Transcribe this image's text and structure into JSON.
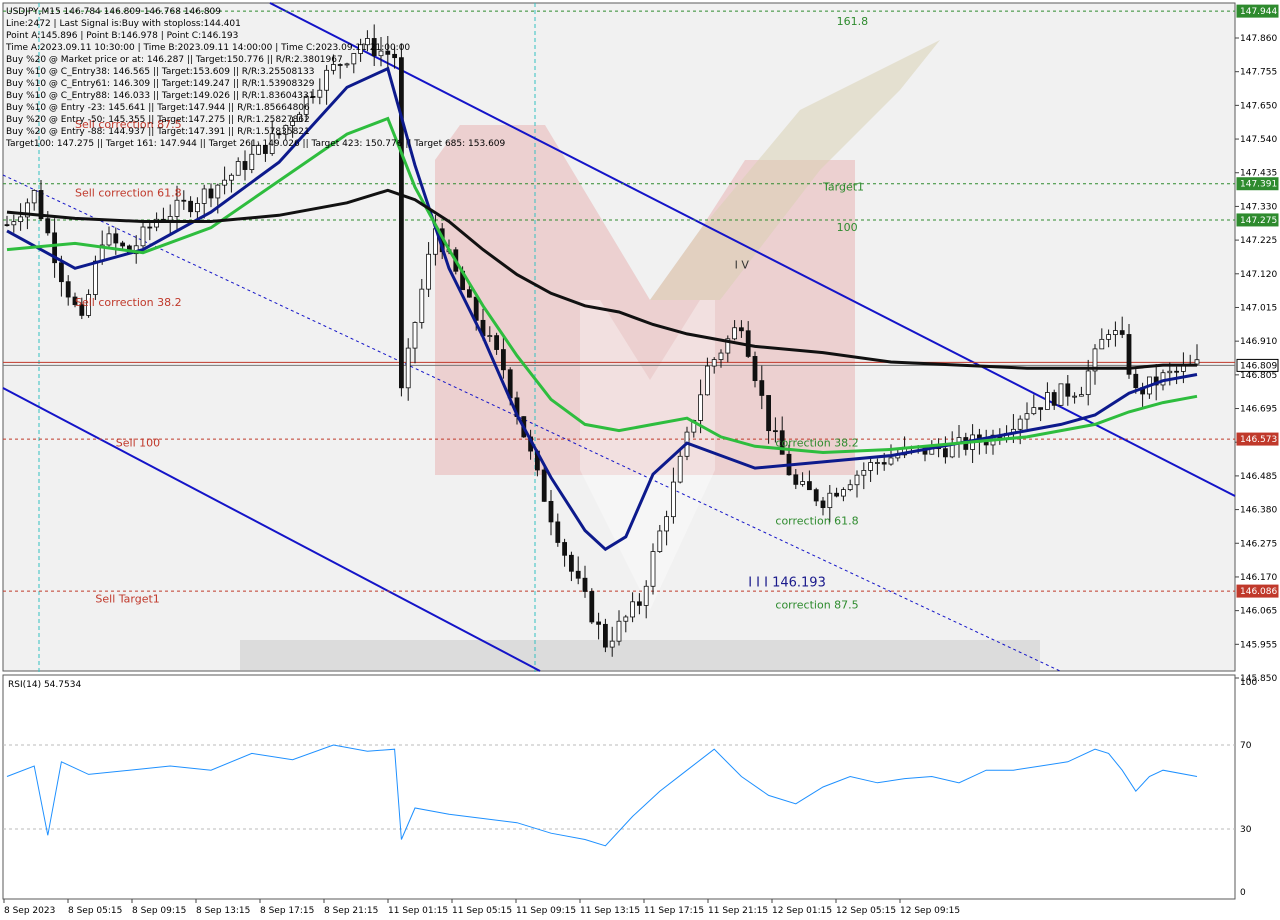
{
  "header": {
    "symbol_line": "USDJPY,M15  146.784 146.809 146.768 146.809",
    "info_lines": [
      "Line:2472 | Last Signal is:Buy with stoploss:144.401",
      "Point A:145.896 | Point B:146.978 | Point C:146.193",
      "Time A:2023.09.11 10:30:00 | Time B:2023.09.11 14:00:00 | Time C:2023.09.11 21:00:00",
      "Buy %20 @ Market price or at: 146.287 || Target:150.776 || R/R:2.3801967",
      "Buy %10 @ C_Entry38: 146.565 || Target:153.609 || R/R:3.25508133",
      "Buy %10 @ C_Entry61: 146.309 || Target:149.247 || R/R:1.53908329",
      "Buy %10 @ C_Entry88: 146.033 || Target:149.026 || R/R:1.83604331",
      "Buy %10 @ Entry -23: 145.641 || Target:147.944 || R/R:1.85664806",
      "Buy %20 @ Entry -50: 145.355 || Target:147.275 || R/R:1.25827862",
      "Buy %20 @ Entry -88: 144.937 || Target:147.391 || R/R:1.57835821",
      "Target100: 147.275 || Target 161: 147.944 || Target 261: 149.026 || Target 423: 150.776 || Target 685: 153.609"
    ]
  },
  "chart_data": {
    "type": "candlestick",
    "title": "USDJPY,M15",
    "x_tick_labels": [
      "8 Sep 2023",
      "8 Sep 05:15",
      "8 Sep 09:15",
      "8 Sep 13:15",
      "8 Sep 17:15",
      "8 Sep 21:15",
      "11 Sep 01:15",
      "11 Sep 05:15",
      "11 Sep 09:15",
      "11 Sep 13:15",
      "11 Sep 17:15",
      "11 Sep 21:15",
      "12 Sep 01:15",
      "12 Sep 05:15",
      "12 Sep 09:15"
    ],
    "price_ticks": [
      "147.860",
      "147.755",
      "147.650",
      "147.540",
      "147.435",
      "147.330",
      "147.225",
      "147.120",
      "147.015",
      "146.910",
      "146.805",
      "146.695",
      "146.590",
      "146.485",
      "146.380",
      "146.275",
      "146.170",
      "146.065",
      "145.955",
      "145.850"
    ],
    "ylim": [
      145.83,
      147.97
    ],
    "price_path": [
      [
        0,
        147.26
      ],
      [
        4,
        147.36
      ],
      [
        8,
        147.1
      ],
      [
        11,
        146.94
      ],
      [
        14,
        147.22
      ],
      [
        18,
        147.17
      ],
      [
        22,
        147.28
      ],
      [
        27,
        147.33
      ],
      [
        33,
        147.42
      ],
      [
        40,
        147.55
      ],
      [
        46,
        147.72
      ],
      [
        52,
        147.84
      ],
      [
        57,
        147.8
      ],
      [
        58,
        146.72
      ],
      [
        60,
        146.95
      ],
      [
        63,
        147.25
      ],
      [
        68,
        147.0
      ],
      [
        73,
        146.8
      ],
      [
        78,
        146.45
      ],
      [
        83,
        146.15
      ],
      [
        88,
        145.92
      ],
      [
        93,
        146.05
      ],
      [
        98,
        146.42
      ],
      [
        103,
        146.8
      ],
      [
        108,
        146.95
      ],
      [
        112,
        146.62
      ],
      [
        116,
        146.42
      ],
      [
        120,
        146.38
      ],
      [
        124,
        146.45
      ],
      [
        128,
        146.5
      ],
      [
        132,
        146.53
      ],
      [
        136,
        146.54
      ],
      [
        140,
        146.55
      ],
      [
        145,
        146.58
      ],
      [
        150,
        146.67
      ],
      [
        155,
        146.72
      ],
      [
        158,
        146.74
      ],
      [
        162,
        146.93
      ],
      [
        164,
        146.88
      ],
      [
        166,
        146.72
      ],
      [
        170,
        146.77
      ],
      [
        175,
        146.81
      ]
    ],
    "moving_averages": [
      {
        "name": "dark-blue",
        "color": "#0d1a8c",
        "points": [
          [
            0,
            147.24
          ],
          [
            10,
            147.12
          ],
          [
            20,
            147.18
          ],
          [
            30,
            147.3
          ],
          [
            40,
            147.46
          ],
          [
            50,
            147.7
          ],
          [
            56,
            147.76
          ],
          [
            60,
            147.45
          ],
          [
            65,
            147.12
          ],
          [
            70,
            146.9
          ],
          [
            75,
            146.65
          ],
          [
            80,
            146.45
          ],
          [
            85,
            146.28
          ],
          [
            88,
            146.22
          ],
          [
            91,
            146.26
          ],
          [
            95,
            146.46
          ],
          [
            100,
            146.56
          ],
          [
            105,
            146.52
          ],
          [
            110,
            146.48
          ],
          [
            120,
            146.5
          ],
          [
            130,
            146.52
          ],
          [
            140,
            146.56
          ],
          [
            150,
            146.6
          ],
          [
            155,
            146.62
          ],
          [
            160,
            146.65
          ],
          [
            165,
            146.72
          ],
          [
            170,
            146.76
          ],
          [
            175,
            146.78
          ]
        ]
      },
      {
        "name": "green",
        "color": "#2ebd3e",
        "points": [
          [
            0,
            147.18
          ],
          [
            10,
            147.2
          ],
          [
            20,
            147.17
          ],
          [
            30,
            147.25
          ],
          [
            40,
            147.4
          ],
          [
            50,
            147.55
          ],
          [
            56,
            147.6
          ],
          [
            60,
            147.38
          ],
          [
            65,
            147.18
          ],
          [
            70,
            147.0
          ],
          [
            75,
            146.84
          ],
          [
            80,
            146.7
          ],
          [
            85,
            146.62
          ],
          [
            90,
            146.6
          ],
          [
            95,
            146.62
          ],
          [
            100,
            146.64
          ],
          [
            105,
            146.58
          ],
          [
            110,
            146.55
          ],
          [
            120,
            146.53
          ],
          [
            130,
            146.54
          ],
          [
            140,
            146.56
          ],
          [
            150,
            146.58
          ],
          [
            155,
            146.6
          ],
          [
            160,
            146.62
          ],
          [
            165,
            146.66
          ],
          [
            170,
            146.69
          ],
          [
            175,
            146.71
          ]
        ]
      },
      {
        "name": "black",
        "color": "#111111",
        "points": [
          [
            0,
            147.3
          ],
          [
            10,
            147.28
          ],
          [
            20,
            147.27
          ],
          [
            30,
            147.27
          ],
          [
            40,
            147.29
          ],
          [
            50,
            147.33
          ],
          [
            56,
            147.37
          ],
          [
            60,
            147.34
          ],
          [
            65,
            147.27
          ],
          [
            70,
            147.18
          ],
          [
            75,
            147.1
          ],
          [
            80,
            147.04
          ],
          [
            85,
            147.0
          ],
          [
            90,
            146.98
          ],
          [
            95,
            146.94
          ],
          [
            100,
            146.91
          ],
          [
            110,
            146.87
          ],
          [
            120,
            146.85
          ],
          [
            130,
            146.82
          ],
          [
            140,
            146.81
          ],
          [
            150,
            146.8
          ],
          [
            160,
            146.8
          ],
          [
            165,
            146.8
          ],
          [
            170,
            146.81
          ],
          [
            175,
            146.81
          ]
        ]
      }
    ],
    "price_labels": [
      {
        "text": "147.944",
        "value": 147.944,
        "color": "#2e8b2e"
      },
      {
        "text": "147.391",
        "value": 147.391,
        "color": "#2e8b2e"
      },
      {
        "text": "147.275",
        "value": 147.275,
        "color": "#2e8b2e"
      },
      {
        "text": "146.809",
        "value": 146.809,
        "color": "#000000"
      },
      {
        "text": "146.573",
        "value": 146.573,
        "color": "#c0392b"
      },
      {
        "text": "146.086",
        "value": 146.086,
        "color": "#c0392b"
      }
    ],
    "annotations": [
      {
        "text": "161.8",
        "x": 122,
        "value": 147.9,
        "color": "#2e8b2e"
      },
      {
        "text": "Target1",
        "x": 120,
        "value": 147.37,
        "color": "#2e8b2e"
      },
      {
        "text": "100",
        "x": 122,
        "value": 147.24,
        "color": "#2e8b2e"
      },
      {
        "text": "I V",
        "x": 107,
        "value": 147.12,
        "color": "#333333"
      },
      {
        "text": "Sell correction 61.8",
        "x": 10,
        "value": 147.35,
        "color": "#c0392b"
      },
      {
        "text": "Sell correction 38.2",
        "x": 10,
        "value": 147.0,
        "color": "#c0392b"
      },
      {
        "text": "Sell correction 87.5",
        "x": 10,
        "value": 147.57,
        "color": "#c0392b"
      },
      {
        "text": "Sell 100",
        "x": 16,
        "value": 146.55,
        "color": "#c0392b"
      },
      {
        "text": "Sell Target1",
        "x": 13,
        "value": 146.05,
        "color": "#c0392b"
      },
      {
        "text": "correction 38.2",
        "x": 113,
        "value": 146.55,
        "color": "#2e8b2e"
      },
      {
        "text": "correction 61.8",
        "x": 113,
        "value": 146.3,
        "color": "#2e8b2e"
      },
      {
        "text": "correction 87.5",
        "x": 113,
        "value": 146.03,
        "color": "#2e8b2e"
      },
      {
        "text": "I I I 146.193",
        "x": 109,
        "value": 146.1,
        "color": "#1a1a8c"
      }
    ],
    "rsi": {
      "label": "RSI(14) 54.7534",
      "levels": [
        "100",
        "70",
        "30",
        "0"
      ],
      "ylim": [
        0,
        100
      ],
      "values": [
        [
          0,
          55
        ],
        [
          4,
          60
        ],
        [
          6,
          27
        ],
        [
          8,
          62
        ],
        [
          12,
          56
        ],
        [
          18,
          58
        ],
        [
          24,
          60
        ],
        [
          30,
          58
        ],
        [
          36,
          66
        ],
        [
          42,
          63
        ],
        [
          48,
          70
        ],
        [
          53,
          67
        ],
        [
          57,
          68
        ],
        [
          58,
          25
        ],
        [
          60,
          40
        ],
        [
          65,
          37
        ],
        [
          70,
          35
        ],
        [
          75,
          33
        ],
        [
          80,
          28
        ],
        [
          85,
          25
        ],
        [
          88,
          22
        ],
        [
          92,
          36
        ],
        [
          96,
          48
        ],
        [
          100,
          58
        ],
        [
          104,
          68
        ],
        [
          108,
          55
        ],
        [
          112,
          46
        ],
        [
          116,
          42
        ],
        [
          120,
          50
        ],
        [
          124,
          55
        ],
        [
          128,
          52
        ],
        [
          132,
          54
        ],
        [
          136,
          55
        ],
        [
          140,
          52
        ],
        [
          144,
          58
        ],
        [
          148,
          58
        ],
        [
          152,
          60
        ],
        [
          156,
          62
        ],
        [
          160,
          68
        ],
        [
          162,
          66
        ],
        [
          164,
          58
        ],
        [
          166,
          48
        ],
        [
          168,
          55
        ],
        [
          170,
          58
        ],
        [
          175,
          55
        ]
      ]
    }
  }
}
